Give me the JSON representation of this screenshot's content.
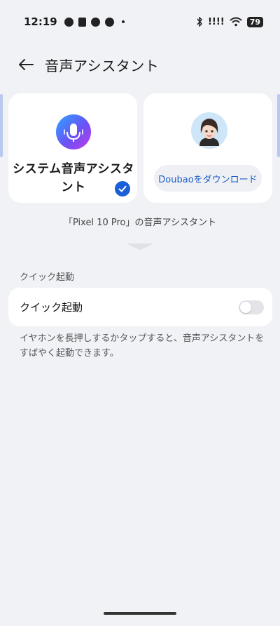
{
  "status_bar": {
    "time": "12:19",
    "battery": "79",
    "signal_text": "!!!!"
  },
  "header": {
    "title": "音声アシスタント",
    "back_icon": "arrow-left-icon"
  },
  "assistants": [
    {
      "label": "システム音声アシスタント",
      "icon": "microphone-icon",
      "selected": true
    },
    {
      "action_label": "Doubaoをダウンロード",
      "icon": "avatar-icon",
      "selected": false
    }
  ],
  "device_caption": "「Pixel 10 Pro」の音声アシスタント",
  "quick_launch": {
    "section_label": "クイック起動",
    "row_label": "クイック起動",
    "enabled": false,
    "help_text": "イヤホンを長押しするかタップすると、音声アシスタントをすばやく起動できます。"
  },
  "colors": {
    "background": "#f1f2f6",
    "accent": "#1a5fd6",
    "link": "#1f5fc8"
  }
}
